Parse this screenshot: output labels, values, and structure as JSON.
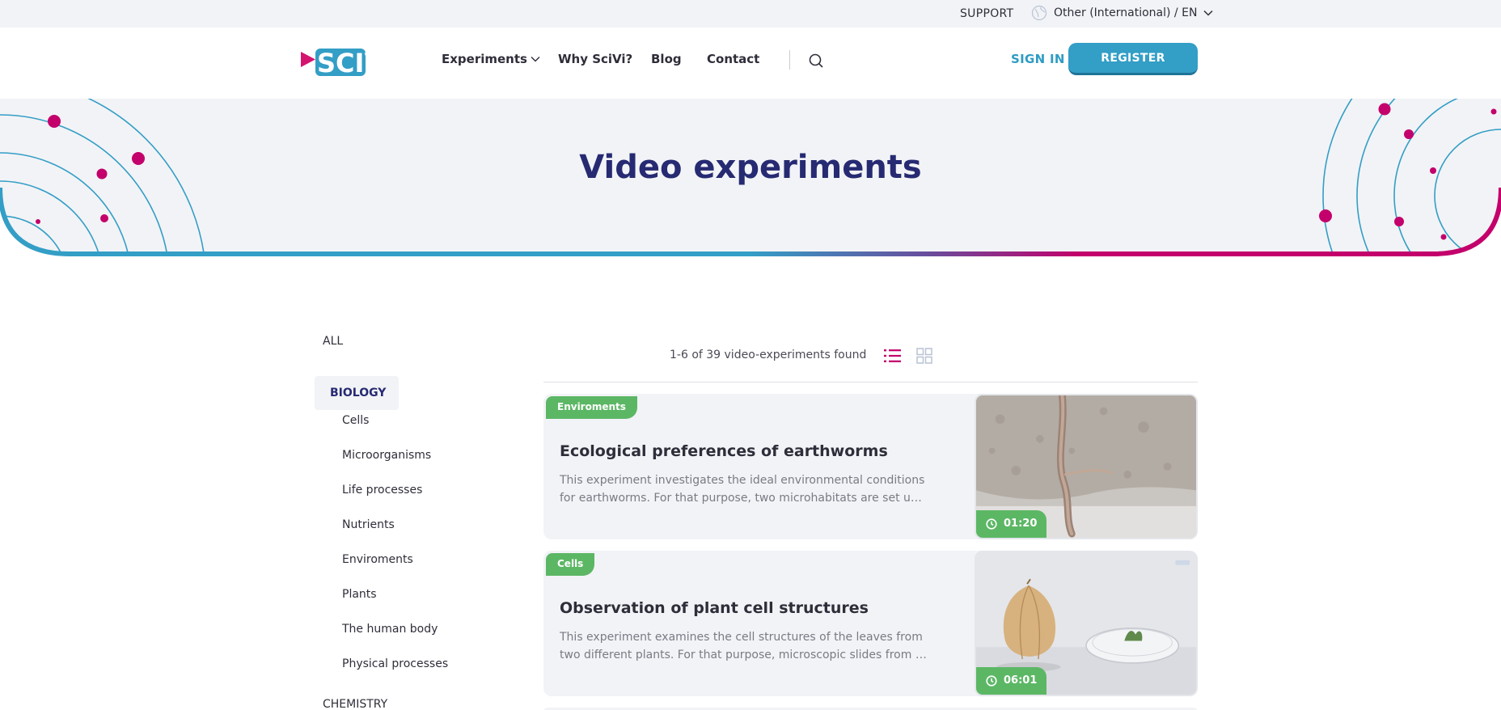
{
  "utility": {
    "support_label": "SUPPORT",
    "language_label": "Other (International) / EN"
  },
  "nav": {
    "logo_text": "SCIVI",
    "experiments_label": "Experiments",
    "why_label": "Why SciVi?",
    "blog_label": "Blog",
    "contact_label": "Contact",
    "signin_label": "SIGN IN",
    "register_label": "REGISTER"
  },
  "hero": {
    "title": "Video experiments"
  },
  "sidebar": {
    "all_label": "ALL",
    "active_category": "BIOLOGY",
    "subcategories": [
      "Cells",
      "Microorganisms",
      "Life processes",
      "Nutrients",
      "Enviroments",
      "Plants",
      "The human body",
      "Physical processes"
    ],
    "next_category": "CHEMISTRY"
  },
  "results": {
    "count_text": "1-6 of 39 video-experiments found"
  },
  "cards": [
    {
      "tag": "Enviroments",
      "title": "Ecological preferences of earthworms",
      "desc_line1": "This experiment investigates the ideal environmental conditions",
      "desc_line2": "for earthworms. For that purpose, two microhabitats are set up i...",
      "duration": "01:20"
    },
    {
      "tag": "Cells",
      "title": "Observation of plant cell structures",
      "desc_line1": "This experiment examines the cell structures of the leaves from",
      "desc_line2": "two different plants. For that purpose, microscopic slides from th...",
      "duration": "06:01"
    }
  ],
  "colors": {
    "brand_navy": "#262a72",
    "brand_blue": "#339ec6",
    "brand_magenta": "#c3006b",
    "tag_green": "#5cb765"
  }
}
